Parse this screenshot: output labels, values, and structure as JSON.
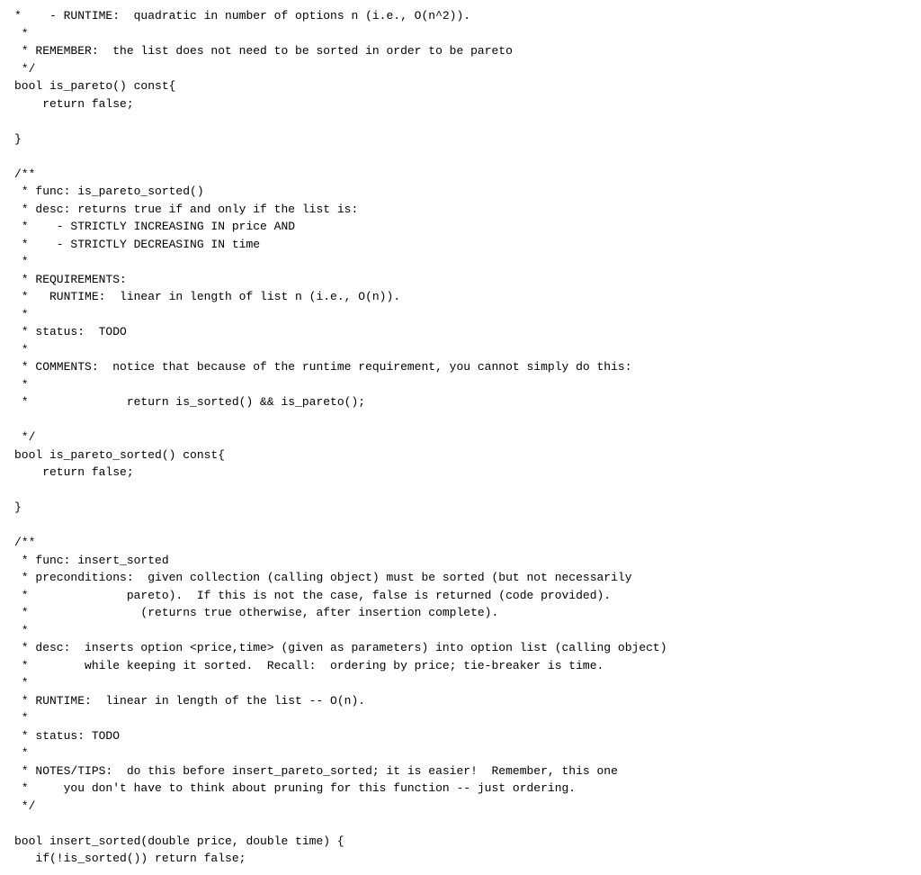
{
  "code": {
    "content": "*    - RUNTIME:  quadratic in number of options n (i.e., O(n^2)).\n *\n * REMEMBER:  the list does not need to be sorted in order to be pareto\n */\nbool is_pareto() const{\n    return false;\n\n}\n\n/**\n * func: is_pareto_sorted()\n * desc: returns true if and only if the list is:\n *    - STRICTLY INCREASING IN price AND\n *    - STRICTLY DECREASING IN time\n *\n * REQUIREMENTS:\n *   RUNTIME:  linear in length of list n (i.e., O(n)).\n *\n * status:  TODO\n *\n * COMMENTS:  notice that because of the runtime requirement, you cannot simply do this:\n *\n *              return is_sorted() && is_pareto();\n\n */\nbool is_pareto_sorted() const{\n    return false;\n\n}\n\n/**\n * func: insert_sorted\n * preconditions:  given collection (calling object) must be sorted (but not necessarily\n *              pareto).  If this is not the case, false is returned (code provided).\n *                (returns true otherwise, after insertion complete).\n *\n * desc:  inserts option <price,time> (given as parameters) into option list (calling object)\n *        while keeping it sorted.  Recall:  ordering by price; tie-breaker is time.\n *\n * RUNTIME:  linear in length of the list -- O(n).\n *\n * status: TODO\n *\n * NOTES/TIPS:  do this before insert_pareto_sorted; it is easier!  Remember, this one\n *     you don't have to think about pruning for this function -- just ordering.\n */\n\nbool insert_sorted(double price, double time) {\n   if(!is_sorted()) return false;"
  }
}
